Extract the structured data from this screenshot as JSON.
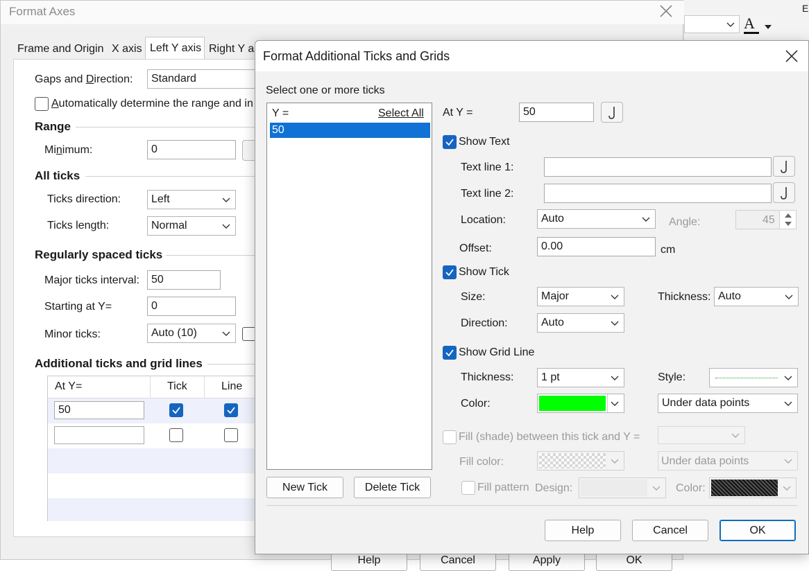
{
  "bg_app": {
    "letter": "E",
    "font_color_glyph": "A"
  },
  "format_axes": {
    "title": "Format Axes",
    "tabs": [
      "Frame and Origin",
      "X axis",
      "Left Y axis",
      "Right Y a"
    ],
    "gaps_label_pre": "Gaps and ",
    "gaps_label_u": "D",
    "gaps_label_post": "irection:",
    "gaps_value": "Standard",
    "auto_pre": "",
    "auto_u": "A",
    "auto_post": "utomatically determine the range and in",
    "range_header": "Range",
    "minimum_pre": "Mi",
    "minimum_u": "n",
    "minimum_post": "imum:",
    "minimum_value": "0",
    "all_ticks_header": "All ticks",
    "ticks_direction_label": "Ticks direction:",
    "ticks_direction_value": "Left",
    "ticks_length_label": "Ticks length:",
    "ticks_length_value": "Normal",
    "regular_header": "Regularly spaced ticks",
    "major_interval_label": "Major ticks interval:",
    "major_interval_value": "50",
    "starting_label": "Starting at Y=",
    "starting_value": "0",
    "minor_label": "Minor ticks:",
    "minor_value": "Auto (10)",
    "additional_header": "Additional ticks and grid lines",
    "table_headers": [
      "At Y=",
      "Tick",
      "Line"
    ],
    "table_rows": [
      {
        "at": "50",
        "tick": true,
        "line": true
      },
      {
        "at": "",
        "tick": false,
        "line": false
      }
    ],
    "bottom_buttons": [
      "Help",
      "Cancel",
      "Apply",
      "OK"
    ]
  },
  "dialog": {
    "title": "Format Additional Ticks and Grids",
    "select_prompt": "Select one or more ticks",
    "list_header": "Y =",
    "select_all": "Select All",
    "list_items": [
      "50"
    ],
    "at_y_label": "At Y =",
    "at_y_value": "50",
    "show_text": "Show Text",
    "text_line1_label": "Text line 1:",
    "text_line1_value": "",
    "text_line2_label": "Text line 2:",
    "text_line2_value": "",
    "location_label": "Location:",
    "location_value": "Auto",
    "angle_label": "Angle:",
    "angle_value": "45",
    "offset_label": "Offset:",
    "offset_value": "0.00",
    "offset_unit": "cm",
    "show_tick": "Show Tick",
    "size_label": "Size:",
    "size_value": "Major",
    "thickness_label": "Thickness:",
    "tick_thickness_value": "Auto",
    "direction_label": "Direction:",
    "direction_value": "Auto",
    "show_grid": "Show Grid Line",
    "grid_thickness_label": "Thickness:",
    "grid_thickness_value": "1 pt",
    "style_label": "Style:",
    "color_label": "Color:",
    "grid_color": "#00ff00",
    "grid_layer_value": "Under data points",
    "fill_label": "Fill (shade) between this tick and Y =",
    "fill_color_label": "Fill color:",
    "fill_layer_value": "Under data points",
    "fill_pattern_label": "Fill pattern",
    "design_label": "Design:",
    "pattern_color_label": "Color:",
    "new_tick": "New Tick",
    "delete_tick": "Delete Tick",
    "help": "Help",
    "cancel": "Cancel",
    "ok": "OK",
    "accent": "#1565c0"
  }
}
